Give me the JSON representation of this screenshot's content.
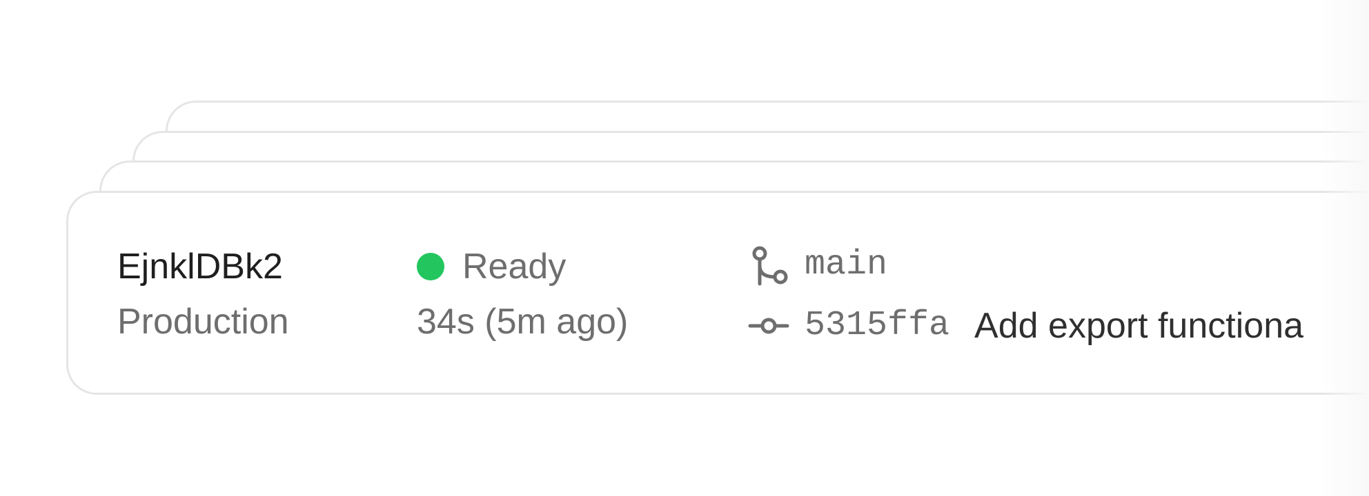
{
  "deployment": {
    "id": "EjnklDBk2",
    "environment": "Production",
    "status": {
      "label": "Ready",
      "color": "#22c55e"
    },
    "duration": "34s (5m ago)",
    "branch": {
      "icon": "git-branch-icon",
      "name": "main"
    },
    "commit": {
      "icon": "git-commit-icon",
      "hash": "5315ffa",
      "message": "Add export functiona"
    }
  }
}
